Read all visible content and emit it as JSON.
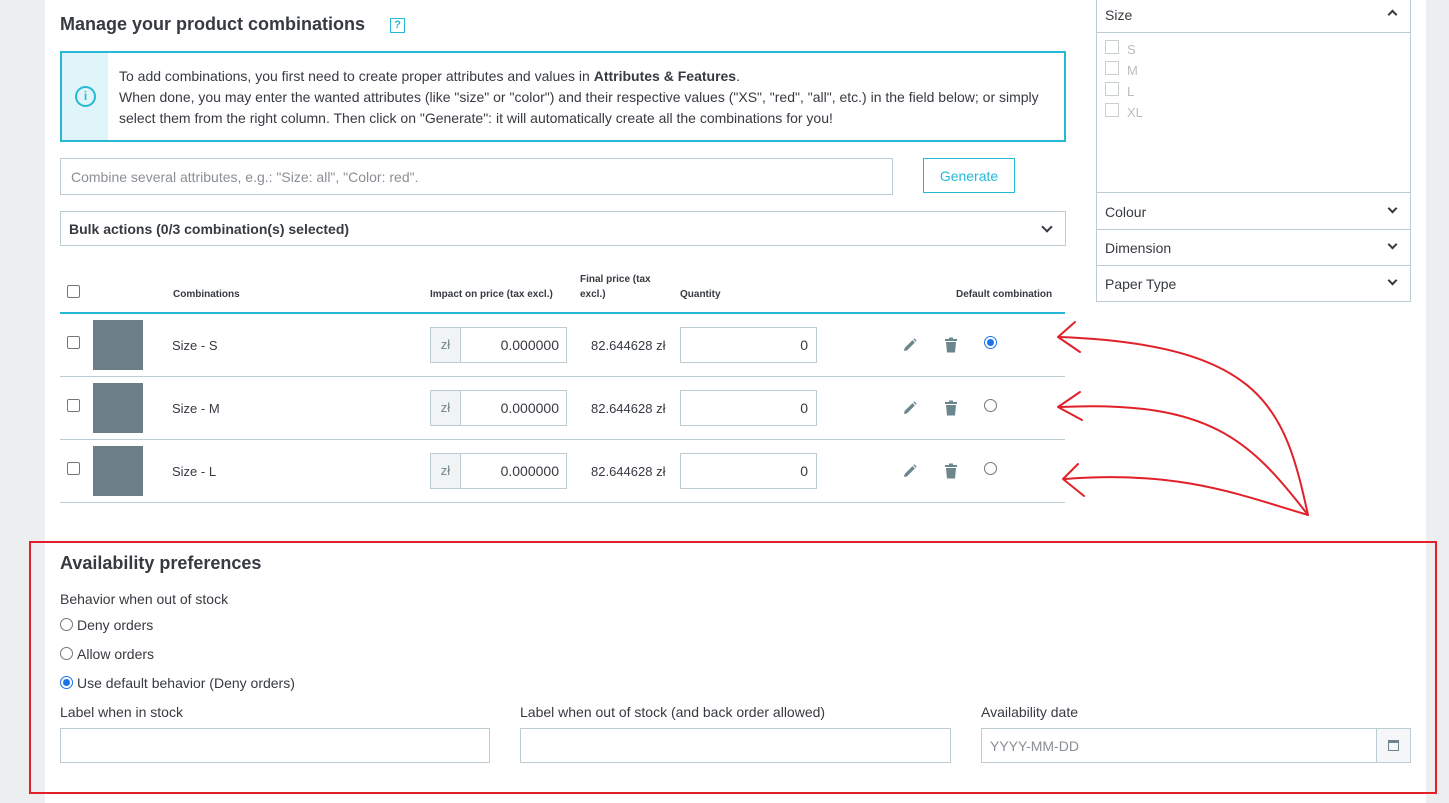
{
  "combinations_section": {
    "title": "Manage your product combinations",
    "help_badge": "?",
    "info": {
      "line1_before": "To add combinations, you first need to create proper attributes and values in ",
      "line1_link": "Attributes & Features",
      "line1_after": ".",
      "rest": "When done, you may enter the wanted attributes (like \"size\" or \"color\") and their respective values (\"XS\", \"red\", \"all\", etc.) in the field below; or simply select them from the right column. Then click on \"Generate\": it will automatically create all the combinations for you!",
      "icon": "info-icon"
    },
    "combine_placeholder": "Combine several attributes, e.g.: \"Size: all\", \"Color: red\".",
    "generate_label": "Generate",
    "bulk_label": "Bulk actions (0/3 combination(s) selected)"
  },
  "table": {
    "headers": {
      "combinations": "Combinations",
      "impact": "Impact on price (tax excl.)",
      "final": "Final price (tax excl.)",
      "quantity": "Quantity",
      "default": "Default combination"
    },
    "rows": [
      {
        "name": "Size - S",
        "currency": "zł",
        "impact": "0.000000",
        "final": "82.644628 zł",
        "quantity": "0",
        "default": true
      },
      {
        "name": "Size - M",
        "currency": "zł",
        "impact": "0.000000",
        "final": "82.644628 zł",
        "quantity": "0",
        "default": false
      },
      {
        "name": "Size - L",
        "currency": "zł",
        "impact": "0.000000",
        "final": "82.644628 zł",
        "quantity": "0",
        "default": false
      }
    ],
    "row_icons": [
      "pencil-icon",
      "trash-icon"
    ],
    "thumb_color": "#6c7f87"
  },
  "attributes_panel": {
    "groups": [
      {
        "label": "Size",
        "expanded": true,
        "options": [
          "S",
          "M",
          "L",
          "XL"
        ]
      },
      {
        "label": "Colour",
        "expanded": false
      },
      {
        "label": "Dimension",
        "expanded": false
      },
      {
        "label": "Paper Type",
        "expanded": false
      }
    ]
  },
  "availability": {
    "title": "Availability preferences",
    "behavior_label": "Behavior when out of stock",
    "options": [
      {
        "label": "Deny orders",
        "selected": false
      },
      {
        "label": "Allow orders",
        "selected": false
      },
      {
        "label": "Use default behavior (Deny orders)",
        "selected": true
      }
    ],
    "label_in_stock": "Label when in stock",
    "label_out_of_stock": "Label when out of stock (and back order allowed)",
    "availability_date_label": "Availability date",
    "date_placeholder": "YYYY-MM-DD",
    "calendar_icon": "calendar-icon"
  },
  "colors": {
    "accent": "#25b9d7",
    "annotation_red": "#e2202a",
    "radio_blue": "#1a73e8"
  }
}
